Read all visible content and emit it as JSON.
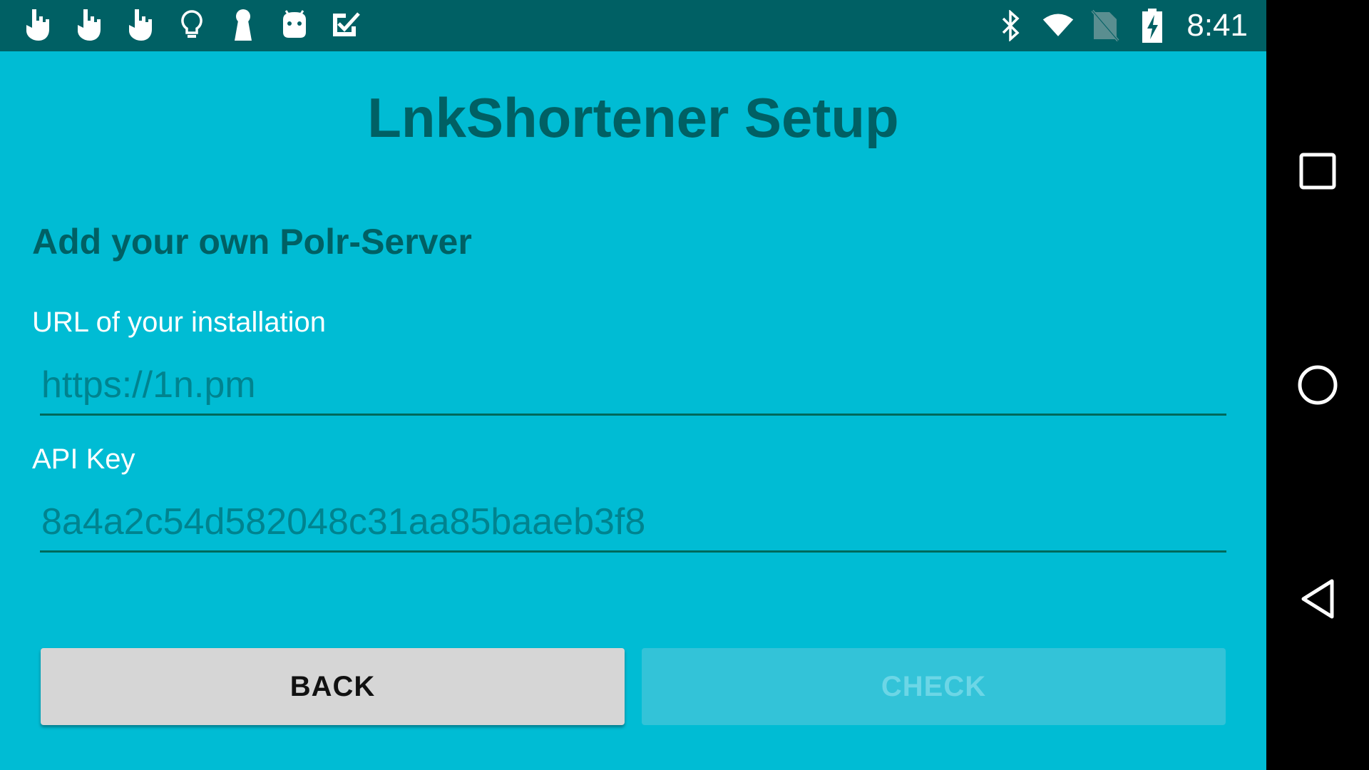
{
  "status_bar": {
    "left_icons": [
      "touch-icon",
      "touch-icon",
      "touch-icon",
      "lightbulb-icon",
      "keyhole-icon",
      "android-icon",
      "checkmark-icon"
    ],
    "right_icons": [
      "bluetooth-icon",
      "wifi-icon",
      "no-sim-icon",
      "battery-charging-icon"
    ],
    "time": "8:41"
  },
  "screen": {
    "title": "LnkShortener Setup",
    "section_heading": "Add your own Polr-Server",
    "url_label": "URL of your installation",
    "url_value": "https://1n.pm",
    "api_label": "API Key",
    "api_value": "8a4a2c54d582048c31aa85baaeb3f8",
    "back_button": "BACK",
    "check_button": "CHECK"
  },
  "nav_bar": {
    "buttons": [
      "recents-icon",
      "home-icon",
      "back-icon"
    ]
  },
  "colors": {
    "background": "#00BCD4",
    "status_bar": "#006064",
    "title_text": "#006064",
    "nav_bar": "#000000"
  }
}
